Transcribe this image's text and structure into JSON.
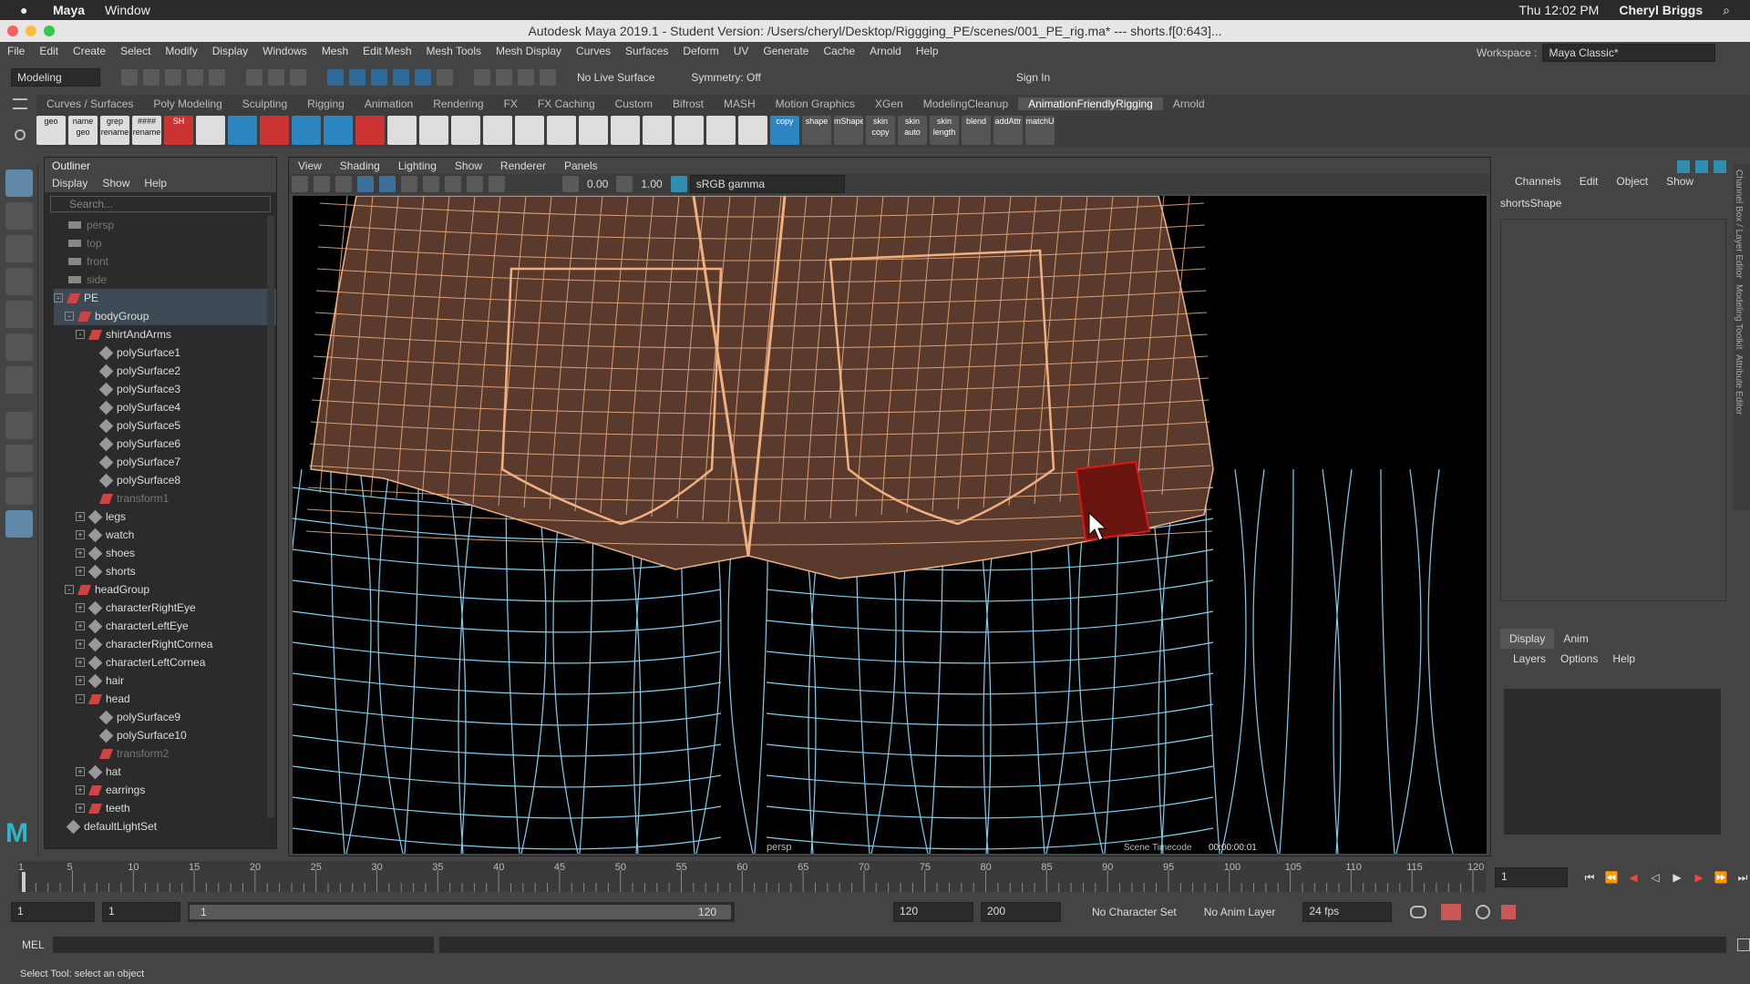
{
  "mac_menubar": {
    "apple": "",
    "app": "Maya",
    "menu": "Window",
    "clock": "Thu 12:02 PM",
    "user": "Cheryl Briggs"
  },
  "window": {
    "title": "Autodesk Maya 2019.1 - Student Version: /Users/cheryl/Desktop/Riggging_PE/scenes/001_PE_rig.ma*   ---   shorts.f[0:643]...",
    "menus": [
      "File",
      "Edit",
      "Create",
      "Select",
      "Modify",
      "Display",
      "Windows",
      "Mesh",
      "Edit Mesh",
      "Mesh Tools",
      "Mesh Display",
      "Curves",
      "Surfaces",
      "Deform",
      "UV",
      "Generate",
      "Cache",
      "Arnold",
      "Help"
    ],
    "workspace_label": "Workspace :",
    "workspace_value": "Maya Classic*"
  },
  "status_line": {
    "mode": "Modeling",
    "live_surface": "No Live Surface",
    "symmetry": "Symmetry: Off",
    "sign_in": "Sign In"
  },
  "shelf": {
    "tabs": [
      "Curves / Surfaces",
      "Poly Modeling",
      "Sculpting",
      "Rigging",
      "Animation",
      "Rendering",
      "FX",
      "FX Caching",
      "Custom",
      "Bifrost",
      "MASH",
      "Motion Graphics",
      "XGen",
      "ModelingCleanup",
      "AnimationFriendlyRigging",
      "Arnold"
    ],
    "active_tab": "AnimationFriendlyRigging",
    "icon_labels": [
      "geo",
      "name geo",
      "grep rename",
      "#### rename",
      "SH",
      "",
      "",
      "",
      "",
      "",
      "",
      "",
      "",
      "",
      "",
      "",
      "",
      "",
      "",
      "",
      "",
      "",
      "",
      "copy",
      "shape",
      "mShape",
      "skin copy",
      "skin auto",
      "skin length",
      "blend",
      "addAttr",
      "matchU"
    ]
  },
  "outliner": {
    "title": "Outliner",
    "menus": [
      "Display",
      "Show",
      "Help"
    ],
    "search_placeholder": "Search...",
    "items": [
      {
        "label": "persp",
        "indent": 0,
        "type": "cam",
        "dim": true
      },
      {
        "label": "top",
        "indent": 0,
        "type": "cam",
        "dim": true
      },
      {
        "label": "front",
        "indent": 0,
        "type": "cam",
        "dim": true
      },
      {
        "label": "side",
        "indent": 0,
        "type": "cam",
        "dim": true
      },
      {
        "label": "PE",
        "indent": 0,
        "type": "grp",
        "exp": "-",
        "sel": true
      },
      {
        "label": "bodyGroup",
        "indent": 1,
        "type": "grp",
        "exp": "-",
        "sel": true
      },
      {
        "label": "shirtAndArms",
        "indent": 2,
        "type": "grp",
        "exp": "-"
      },
      {
        "label": "polySurface1",
        "indent": 3,
        "type": "mesh"
      },
      {
        "label": "polySurface2",
        "indent": 3,
        "type": "mesh"
      },
      {
        "label": "polySurface3",
        "indent": 3,
        "type": "mesh"
      },
      {
        "label": "polySurface4",
        "indent": 3,
        "type": "mesh"
      },
      {
        "label": "polySurface5",
        "indent": 3,
        "type": "mesh"
      },
      {
        "label": "polySurface6",
        "indent": 3,
        "type": "mesh"
      },
      {
        "label": "polySurface7",
        "indent": 3,
        "type": "mesh"
      },
      {
        "label": "polySurface8",
        "indent": 3,
        "type": "mesh"
      },
      {
        "label": "transform1",
        "indent": 3,
        "type": "grp",
        "dim": true
      },
      {
        "label": "legs",
        "indent": 2,
        "type": "mesh",
        "exp": "+"
      },
      {
        "label": "watch",
        "indent": 2,
        "type": "mesh",
        "exp": "+"
      },
      {
        "label": "shoes",
        "indent": 2,
        "type": "mesh",
        "exp": "+"
      },
      {
        "label": "shorts",
        "indent": 2,
        "type": "mesh",
        "exp": "+"
      },
      {
        "label": "headGroup",
        "indent": 1,
        "type": "grp",
        "exp": "-"
      },
      {
        "label": "characterRightEye",
        "indent": 2,
        "type": "mesh",
        "exp": "+"
      },
      {
        "label": "characterLeftEye",
        "indent": 2,
        "type": "mesh",
        "exp": "+"
      },
      {
        "label": "characterRightCornea",
        "indent": 2,
        "type": "mesh",
        "exp": "+"
      },
      {
        "label": "characterLeftCornea",
        "indent": 2,
        "type": "mesh",
        "exp": "+"
      },
      {
        "label": "hair",
        "indent": 2,
        "type": "mesh",
        "exp": "+"
      },
      {
        "label": "head",
        "indent": 2,
        "type": "grp",
        "exp": "-"
      },
      {
        "label": "polySurface9",
        "indent": 3,
        "type": "mesh"
      },
      {
        "label": "polySurface10",
        "indent": 3,
        "type": "mesh"
      },
      {
        "label": "transform2",
        "indent": 3,
        "type": "grp",
        "dim": true
      },
      {
        "label": "hat",
        "indent": 2,
        "type": "mesh",
        "exp": "+"
      },
      {
        "label": "earrings",
        "indent": 2,
        "type": "grp",
        "exp": "+"
      },
      {
        "label": "teeth",
        "indent": 2,
        "type": "grp",
        "exp": "+"
      },
      {
        "label": "defaultLightSet",
        "indent": 0,
        "type": "set"
      }
    ]
  },
  "viewport": {
    "menus": [
      "View",
      "Shading",
      "Lighting",
      "Show",
      "Renderer",
      "Panels"
    ],
    "field1": "0.00",
    "field2": "1.00",
    "color_space": "sRGB gamma",
    "hud_scene_timecode": "Scene Timecode",
    "hud_timecode": "00:00:00:01",
    "hud_persp": "persp"
  },
  "channel_box": {
    "menus": [
      "Channels",
      "Edit",
      "Object",
      "Show"
    ],
    "object": "shortsShape"
  },
  "layer_editor": {
    "tabs": [
      "Display",
      "Anim"
    ],
    "active_tab": "Display",
    "menus": [
      "Layers",
      "Options",
      "Help"
    ]
  },
  "side_tabs": [
    "Channel Box / Layer Editor",
    "Modeling Toolkit",
    "Attribute Editor"
  ],
  "timeline": {
    "ticks": [
      "1",
      "5",
      "10",
      "15",
      "20",
      "25",
      "30",
      "35",
      "40",
      "45",
      "50",
      "55",
      "60",
      "65",
      "70",
      "75",
      "80",
      "85",
      "90",
      "95",
      "100",
      "105",
      "110",
      "115",
      "120"
    ],
    "current_frame": "1"
  },
  "range": {
    "start": "1",
    "playback_start": "1",
    "slider_start": "1",
    "slider_end": "120",
    "playback_end": "120",
    "end": "200",
    "character_set": "No Character Set",
    "anim_layer": "No Anim Layer",
    "fps": "24 fps"
  },
  "mel": {
    "label": "MEL"
  },
  "help_line": "Select Tool: select an object",
  "colors": {
    "wire_orange": "#f0b080",
    "wire_blue": "#7fd0f0",
    "shorts_fill": "#5a3a2c",
    "selection": "#c41010"
  }
}
